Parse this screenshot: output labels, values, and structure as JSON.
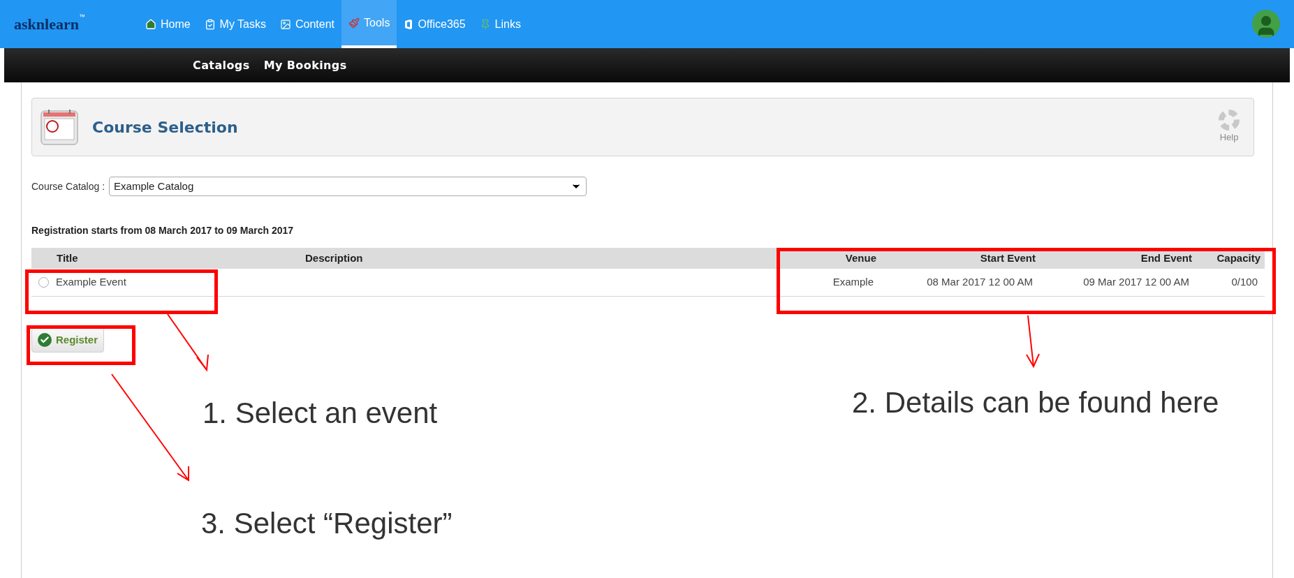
{
  "header": {
    "logo": "asknlearn",
    "logo_mark": "™",
    "nav": [
      {
        "label": "Home",
        "kind": "home",
        "selected": false
      },
      {
        "label": "My Tasks",
        "kind": "tasks",
        "selected": false
      },
      {
        "label": "Content",
        "kind": "content",
        "selected": false
      },
      {
        "label": "Tools",
        "kind": "tools",
        "selected": true
      },
      {
        "label": "Office365",
        "kind": "office",
        "selected": false
      },
      {
        "label": "Links",
        "kind": "links",
        "selected": false
      }
    ]
  },
  "subnav": [
    "Catalogs",
    "My Bookings"
  ],
  "panel": {
    "title": "Course Selection",
    "help": "Help"
  },
  "catalog": {
    "label": "Course Catalog :",
    "value": "Example Catalog"
  },
  "registration_note": "Registration starts from 08 March 2017 to 09 March 2017",
  "table": {
    "columns": [
      "Title",
      "Description",
      "Venue",
      "Start Event",
      "End Event",
      "Capacity"
    ],
    "rows": [
      {
        "selected": false,
        "cells": [
          "Example Event",
          "",
          "Example",
          "08 Mar 2017 12 00 AM",
          "09 Mar 2017 12 00 AM",
          "0/100"
        ]
      }
    ]
  },
  "register_button": "Register",
  "annotations": [
    "1. Select an event",
    "2. Details can be found here",
    "3. Select “Register”"
  ]
}
